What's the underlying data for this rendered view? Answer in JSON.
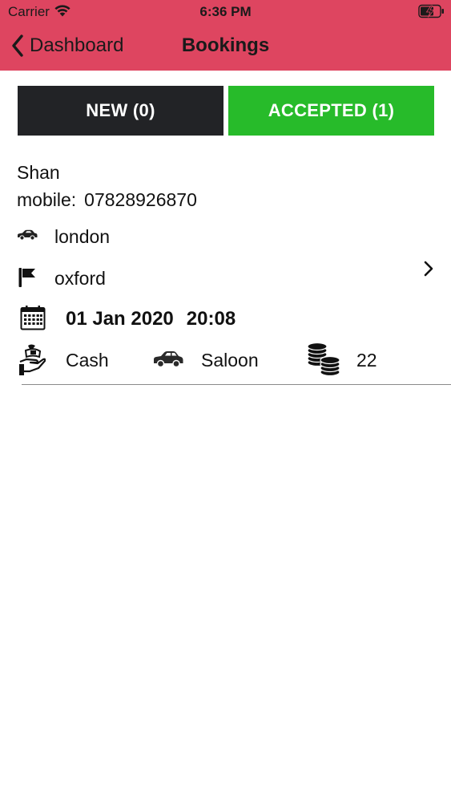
{
  "status_bar": {
    "carrier": "Carrier",
    "time": "6:36 PM",
    "wifi_icon": "wifi-icon",
    "battery_icon": "battery-charging-icon"
  },
  "nav": {
    "back_label": "Dashboard",
    "title": "Bookings",
    "background_color": "#de4560"
  },
  "tabs": [
    {
      "label": "NEW (0)",
      "color": "#222326",
      "selected": false
    },
    {
      "label": "ACCEPTED (1)",
      "color": "#27bb2a",
      "selected": true
    }
  ],
  "booking": {
    "name": "Shan",
    "mobile_label": "mobile:",
    "mobile": "07828926870",
    "pickup": "london",
    "dropoff": "oxford",
    "date": "01 Jan 2020",
    "time": "20:08",
    "payment": "Cash",
    "vehicle": "Saloon",
    "fare": "22"
  }
}
